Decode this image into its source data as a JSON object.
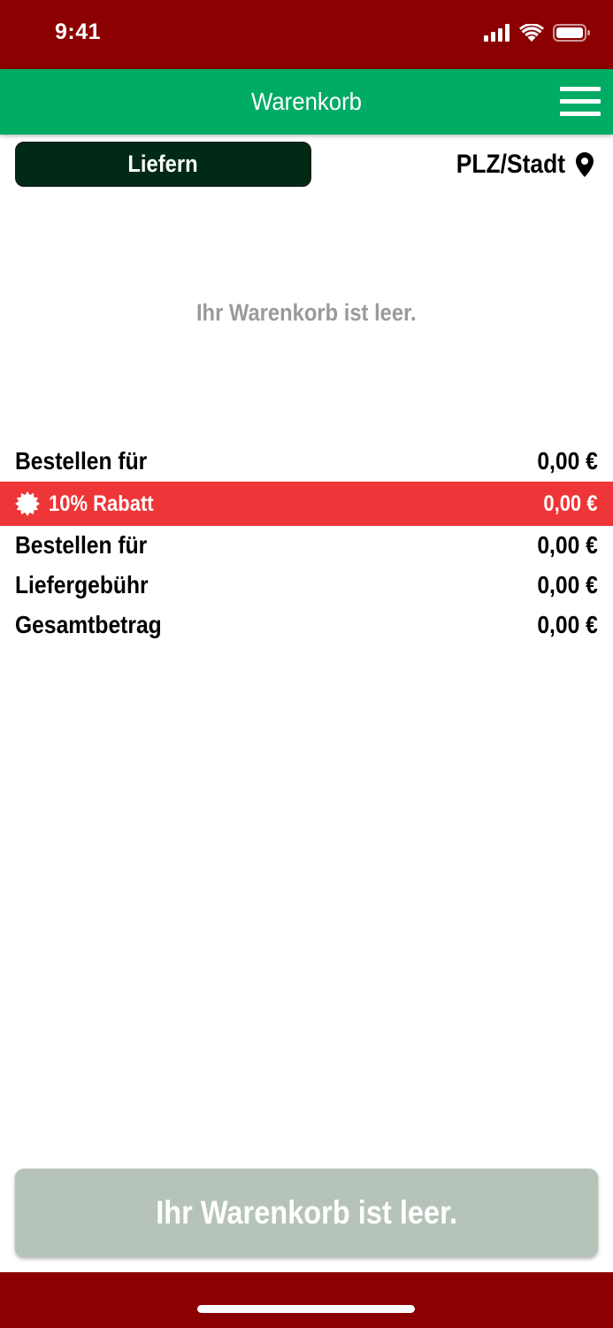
{
  "status_bar": {
    "time": "9:41"
  },
  "app_bar": {
    "title": "Warenkorb"
  },
  "delivery": {
    "mode_label": "Liefern",
    "location_label": "PLZ/Stadt"
  },
  "cart": {
    "empty_message": "Ihr Warenkorb ist leer."
  },
  "summary": {
    "rows": [
      {
        "label": "Bestellen für",
        "value": "0,00 €"
      },
      {
        "label": "10% Rabatt",
        "value": "0,00 €"
      },
      {
        "label": "Bestellen für",
        "value": "0,00 €"
      },
      {
        "label": "Liefergebühr",
        "value": "0,00 €"
      },
      {
        "label": "Gesamtbetrag",
        "value": "0,00 €"
      }
    ]
  },
  "checkout": {
    "label": "Ihr Warenkorb ist leer."
  },
  "colors": {
    "status_bar": "#8b0000",
    "app_bar": "#00ab63",
    "deliver_button": "#002a16",
    "discount": "#ee3537",
    "checkout_disabled": "#b6c3b8"
  }
}
